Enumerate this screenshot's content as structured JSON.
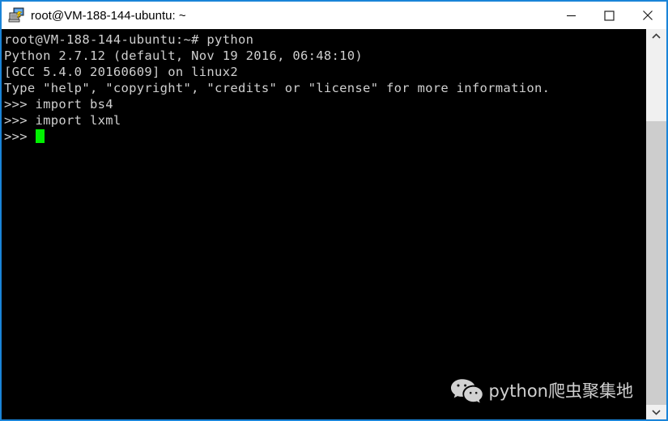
{
  "window": {
    "title": "root@VM-188-144-ubuntu: ~",
    "icon": "putty-icon",
    "border_color": "#1a84d8",
    "titlebar_bg": "#ffffff",
    "title_color": "#000000",
    "controls": [
      {
        "name": "minimize",
        "label": "—"
      },
      {
        "name": "maximize",
        "label": "□"
      },
      {
        "name": "close",
        "label": "✕"
      }
    ]
  },
  "terminal": {
    "background": "#000000",
    "foreground": "#cfcfcf",
    "cursor_color": "#00f000",
    "lines": [
      "root@VM-188-144-ubuntu:~# python",
      "Python 2.7.12 (default, Nov 19 2016, 06:48:10)",
      "[GCC 5.4.0 20160609] on linux2",
      "Type \"help\", \"copyright\", \"credits\" or \"license\" for more information.",
      ">>> import bs4",
      ">>> import lxml"
    ],
    "prompt": ">>> "
  },
  "watermark": {
    "icon": "wechat-icon",
    "text": "python爬虫聚集地",
    "color": "#e2e2e2"
  },
  "scrollbar": {
    "up_arrow": "chevron-up-icon",
    "down_arrow": "chevron-down-icon",
    "track_color": "#f0f0f0",
    "thumb_color": "#cdcdcd"
  }
}
